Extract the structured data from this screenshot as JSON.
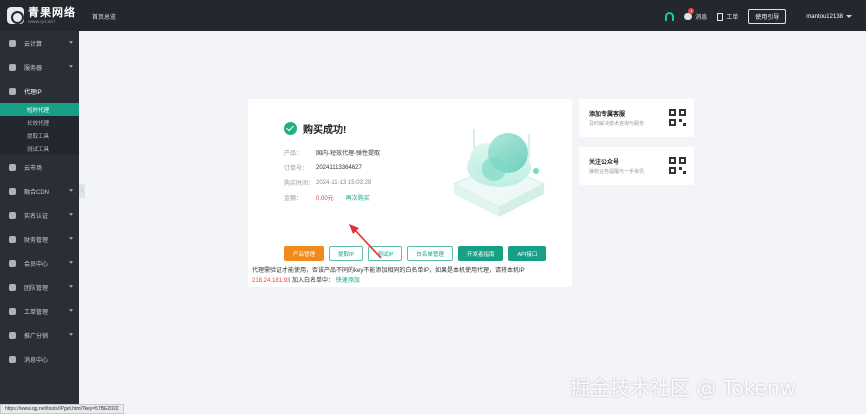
{
  "brand": {
    "name": "青果网络",
    "url": "WWW.QG.NET"
  },
  "header": {
    "home": "首页总览",
    "support_label": "",
    "messages_label": "消息",
    "messages_badge": "1",
    "orders_label": "工单",
    "guide_button": "使用引导",
    "username": "mantou12138"
  },
  "sidebar": {
    "items": [
      {
        "label": "云计算"
      },
      {
        "label": "服务器"
      },
      {
        "label": "代理IP"
      },
      {
        "label": "云市场"
      },
      {
        "label": "融合CDN"
      },
      {
        "label": "实名认证"
      },
      {
        "label": "财务管理"
      },
      {
        "label": "会员中心"
      },
      {
        "label": "团队管理"
      },
      {
        "label": "工单管理"
      },
      {
        "label": "推广分销"
      },
      {
        "label": "消息中心"
      }
    ],
    "sub_items": [
      {
        "label": "短时代理"
      },
      {
        "label": "长效代理"
      },
      {
        "label": "提取工具"
      },
      {
        "label": "测试工具"
      }
    ]
  },
  "success": {
    "title": "购买成功!",
    "rows": [
      {
        "key": "产品：",
        "value": "国内-短效代理-弹性提取"
      },
      {
        "key": "订单号：",
        "value": "20241113364627"
      },
      {
        "key": "购买时间：",
        "value": "2024-11-13 15:03:29"
      },
      {
        "key": "金额：",
        "value": "0.00元",
        "extra": "再次购买"
      }
    ],
    "buttons": [
      {
        "label": "产品管理"
      },
      {
        "label": "提取IP"
      },
      {
        "label": "测试IP"
      },
      {
        "label": "白名单管理"
      },
      {
        "label": "开发者指南"
      },
      {
        "label": "API接口"
      }
    ]
  },
  "side_cards": [
    {
      "title": "添加专属客服",
      "desc": "及时解决技术咨询与服务"
    },
    {
      "title": "关注公众号",
      "desc": "接收业务提醒与一手资讯"
    }
  ],
  "notice": {
    "text1": "代理需验证才能使用，否该产品不同的key不能添加相同的白名单IP，如果是本机使用代理，请将本机IP",
    "ip": "218.24.181.93",
    "text2": "加入白名单中：",
    "link": "快速添加"
  },
  "status_url": "https://www.qg.net/tools/IPget.html?key=57BE2022",
  "watermark": "掘金技术社区 @ Tokenw",
  "colors": {
    "accent": "#17a085",
    "orange": "#ef8a1c",
    "danger": "#e64545",
    "sidebar": "#2a2f37"
  }
}
